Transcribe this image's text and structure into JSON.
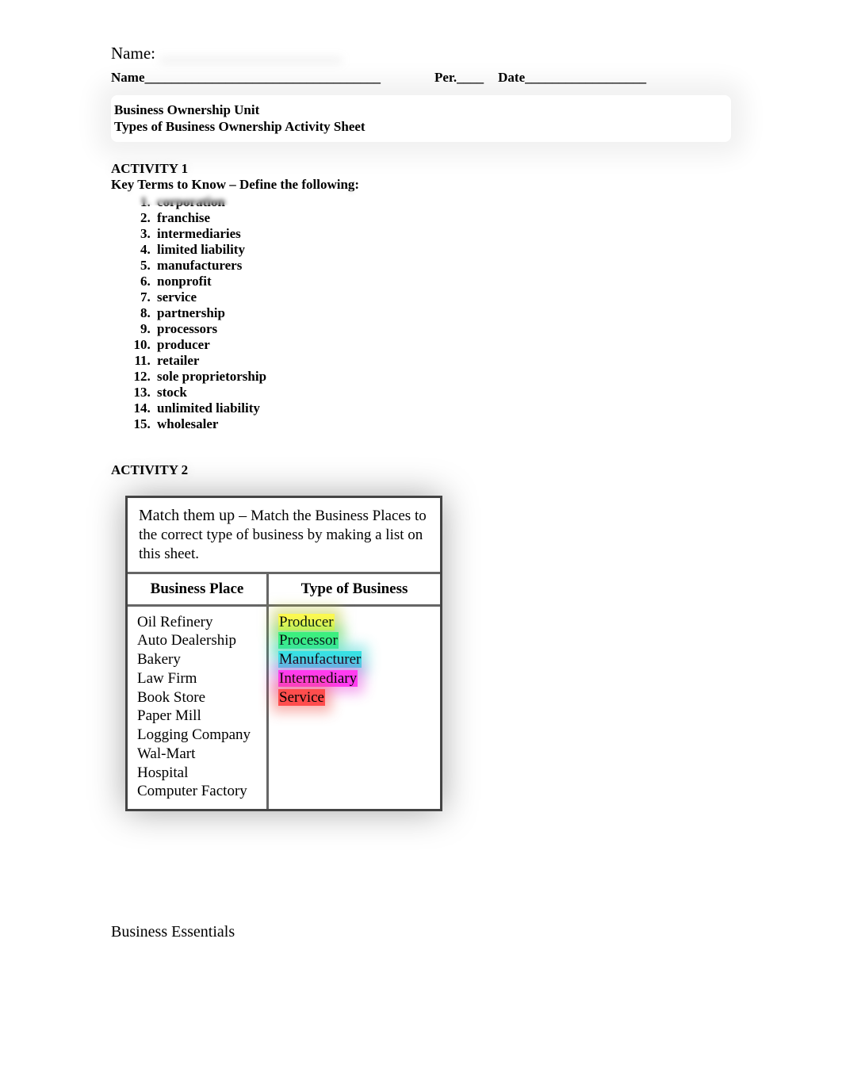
{
  "top": {
    "name_label": "Name:",
    "blur_placeholder": "________________________"
  },
  "form": {
    "name_label": "Name",
    "name_blank": "___________________________________",
    "per_label": "Per.",
    "per_blank": "____",
    "date_label": "Date",
    "date_blank": "__________________"
  },
  "header": {
    "line1": "Business Ownership Unit",
    "line2": "Types of Business Ownership Activity Sheet"
  },
  "activity1": {
    "heading": "ACTIVITY 1",
    "subheading": "Key Terms to Know – Define the following:",
    "terms": [
      "corporation",
      "franchise",
      "intermediaries",
      "limited liability",
      "manufacturers",
      "nonprofit",
      "service",
      "partnership",
      "processors",
      "producer",
      "retailer",
      "sole proprietorship",
      "stock",
      "unlimited liability",
      "wholesaler"
    ]
  },
  "activity2": {
    "heading": "ACTIVITY 2",
    "instruction_lead": "Match them up – ",
    "instruction_rest": "Match the Business Places to the correct type of business by making a list on this sheet.",
    "columns": {
      "a": "Business Place",
      "b": "Type of Business"
    },
    "places": [
      "Oil Refinery",
      "Auto Dealership",
      "Bakery",
      "Law Firm",
      "Book Store",
      "Paper Mill",
      "Logging Company",
      "Wal-Mart",
      "Hospital",
      "Computer Factory"
    ],
    "types": {
      "producer": "Producer",
      "processor": "Processor",
      "manufacturer": "Manufacturer",
      "intermediary": "Intermediary",
      "service": "Service"
    }
  },
  "footer": "Business Essentials"
}
